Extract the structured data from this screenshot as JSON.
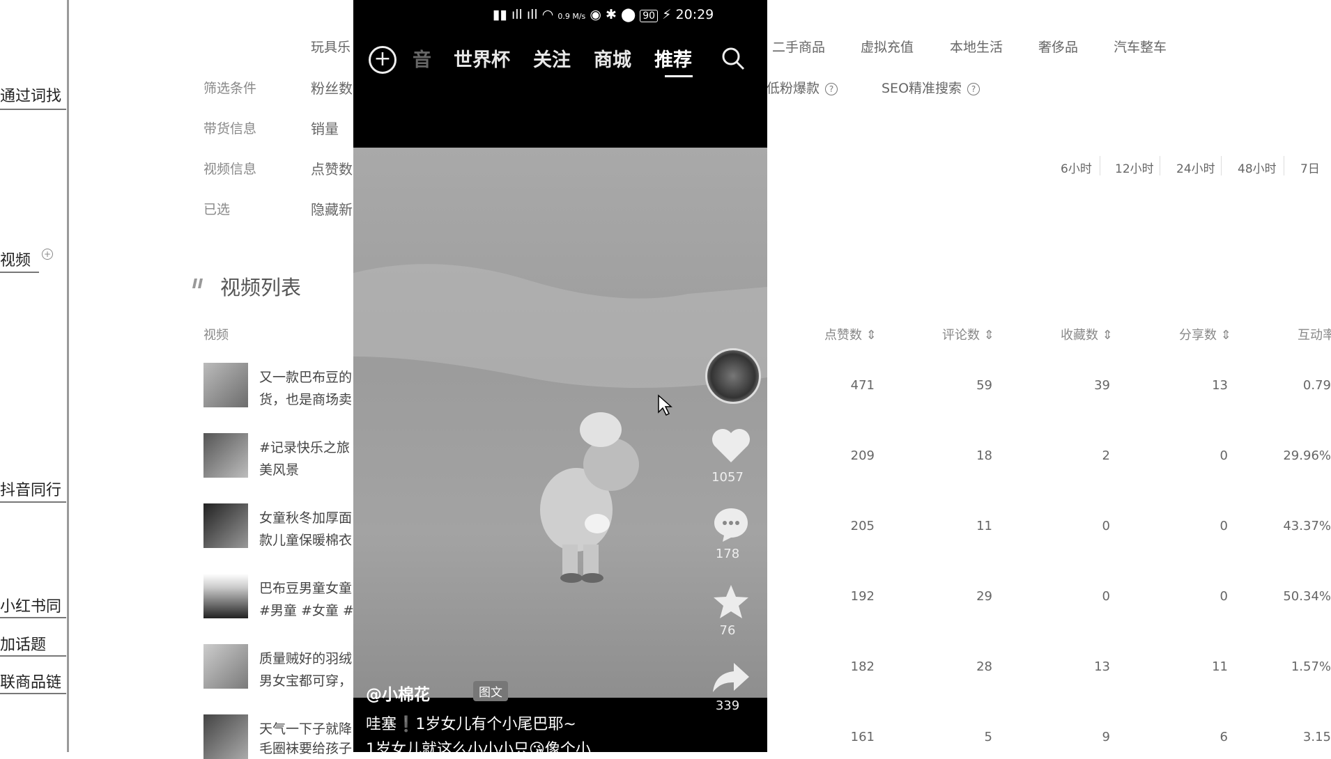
{
  "left_nav": {
    "item1": "通过词找",
    "item2": "视频",
    "item3": "抖音同行",
    "item4": "小红书同",
    "item5": "加话题",
    "item6": "联商品链"
  },
  "categories": [
    "玩具乐",
    "二手商品",
    "虚拟充值",
    "本地生活",
    "奢侈品",
    "汽车整车"
  ],
  "filters": {
    "row1_label": "筛选条件",
    "row1_value": "粉丝数",
    "row1_opt1": "低粉爆款",
    "row1_opt2": "SEO精准搜索",
    "row2_label": "带货信息",
    "row2_value": "销量",
    "row3_label": "视频信息",
    "row3_value": "点赞数",
    "row4_label": "已选",
    "row4_value": "隐藏新"
  },
  "time_ranges": [
    "6小时",
    "12小时",
    "24小时",
    "48小时",
    "7日"
  ],
  "section_title": "视频列表",
  "columns": {
    "video": "视频",
    "likes": "点赞数",
    "comments": "评论数",
    "favorites": "收藏数",
    "shares": "分享数",
    "engagement": "互动率"
  },
  "rows": [
    {
      "line1": "又一款巴布豆的",
      "line2": "货，也是商场卖",
      "likes": "471",
      "comments": "59",
      "favorites": "39",
      "shares": "13",
      "rate": "0.79"
    },
    {
      "line1": "#记录快乐之旅",
      "line2": "美风景",
      "likes": "209",
      "comments": "18",
      "favorites": "2",
      "shares": "0",
      "rate": "29.96%"
    },
    {
      "line1": "女童秋冬加厚面",
      "line2": "款儿童保暖棉衣",
      "likes": "205",
      "comments": "11",
      "favorites": "0",
      "shares": "0",
      "rate": "43.37%"
    },
    {
      "line1": "巴布豆男童女童",
      "line2": "#男童 #女童 #",
      "likes": "192",
      "comments": "29",
      "favorites": "0",
      "shares": "0",
      "rate": "50.34%"
    },
    {
      "line1": "质量贼好的羽绒",
      "line2": "男女宝都可穿，",
      "likes": "182",
      "comments": "28",
      "favorites": "13",
      "shares": "11",
      "rate": "1.57%"
    },
    {
      "line1": "天气一下子就降",
      "line2": "毛圈袜要给孩子",
      "likes": "161",
      "comments": "5",
      "favorites": "9",
      "shares": "6",
      "rate": "3.15"
    }
  ],
  "phone": {
    "status_time": "20:29",
    "status_net": "0.9 M/s",
    "battery": "90",
    "nav_tabs": [
      "音",
      "世界杯",
      "关注",
      "商城",
      "推荐"
    ],
    "active_tab": "推荐",
    "like_count": "1057",
    "comment_count": "178",
    "favorite_count": "76",
    "share_count": "339",
    "author": "@小棉花",
    "badge": "图文",
    "caption1": "哇塞❗1岁女儿有个小尾巴耶~",
    "caption2": "1岁女儿就这么小小小只😘像个小"
  }
}
